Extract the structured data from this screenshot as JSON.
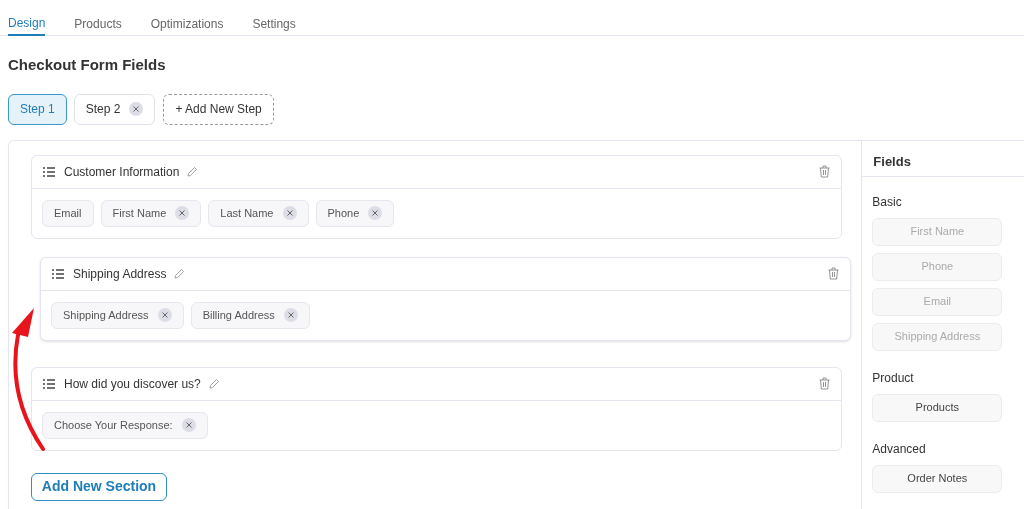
{
  "tabs": [
    {
      "label": "Design",
      "selected": true
    },
    {
      "label": "Products",
      "selected": false
    },
    {
      "label": "Optimizations",
      "selected": false
    },
    {
      "label": "Settings",
      "selected": false
    }
  ],
  "title": "Checkout Form Fields",
  "steps": [
    {
      "label": "Step 1",
      "selected": true,
      "removable": false
    },
    {
      "label": "Step 2",
      "selected": false,
      "removable": true
    }
  ],
  "add_step": "+ Add New Step",
  "sections": [
    {
      "title": "Customer Information",
      "dragging": false,
      "fields": [
        {
          "label": "Email",
          "removable": false
        },
        {
          "label": "First Name",
          "removable": true
        },
        {
          "label": "Last Name",
          "removable": true
        },
        {
          "label": "Phone",
          "removable": true
        }
      ]
    },
    {
      "title": "Shipping Address",
      "dragging": true,
      "fields": [
        {
          "label": "Shipping Address",
          "removable": true
        },
        {
          "label": "Billing Address",
          "removable": true
        }
      ]
    },
    {
      "title": "How did you discover us?",
      "dragging": false,
      "fields": [
        {
          "label": "Choose Your Response:",
          "removable": true
        }
      ]
    }
  ],
  "add_section": "Add New Section",
  "panel": {
    "title": "Fields",
    "groups": [
      {
        "title": "Basic",
        "items": [
          {
            "label": "First Name",
            "disabled": true
          },
          {
            "label": "Phone",
            "disabled": true
          },
          {
            "label": "Email",
            "disabled": true
          },
          {
            "label": "Shipping Address",
            "disabled": true
          }
        ]
      },
      {
        "title": "Product",
        "items": [
          {
            "label": "Products",
            "disabled": false
          }
        ]
      },
      {
        "title": "Advanced",
        "items": [
          {
            "label": "Order Notes",
            "disabled": false
          }
        ]
      }
    ]
  }
}
